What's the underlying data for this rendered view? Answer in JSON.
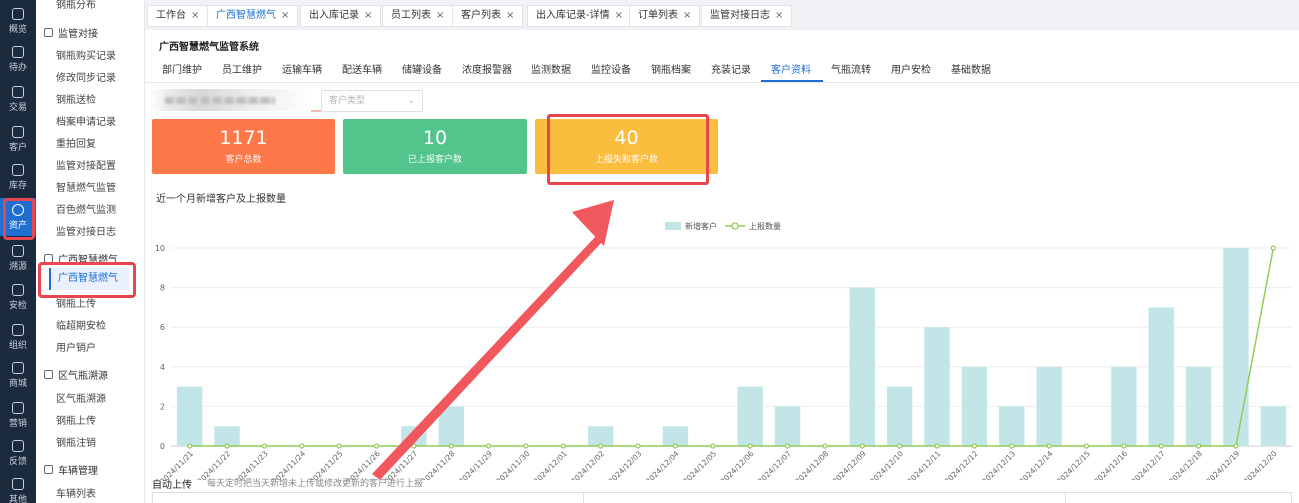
{
  "rail": {
    "items": [
      {
        "label": "概览",
        "icon": "overview-icon"
      },
      {
        "label": "待办",
        "icon": "todo-icon"
      },
      {
        "label": "交易",
        "icon": "transaction-icon"
      },
      {
        "label": "客户",
        "icon": "customer-icon"
      },
      {
        "label": "库存",
        "icon": "inventory-icon"
      },
      {
        "label": "资产",
        "icon": "asset-icon"
      },
      {
        "label": "溯源",
        "icon": "trace-icon"
      },
      {
        "label": "安检",
        "icon": "inspection-icon"
      },
      {
        "label": "组织",
        "icon": "org-icon"
      },
      {
        "label": "商城",
        "icon": "mall-icon"
      },
      {
        "label": "营销",
        "icon": "marketing-icon"
      },
      {
        "label": "反馈",
        "icon": "feedback-icon"
      },
      {
        "label": "其他",
        "icon": "other-icon"
      }
    ]
  },
  "nav": {
    "top_item": "钢瓶分布",
    "group_supervision": "监管对接",
    "supervision_items": [
      "钢瓶购买记录",
      "修改同步记录",
      "钢瓶送检",
      "档案申请记录",
      "重拍回复",
      "监管对接配置",
      "智慧燃气监管",
      "百色燃气监测",
      "监管对接日志"
    ],
    "group_guangxi": "广西智慧燃气",
    "guangxi_items": [
      "广西智慧燃气",
      "钢瓶上传",
      "临超期安检",
      "用户销户"
    ],
    "group_district": "区气瓶溯源",
    "district_items": [
      "区气瓶溯源",
      "钢瓶上传",
      "钢瓶注销"
    ],
    "group_vehicle": "车辆管理",
    "vehicle_items": [
      "车辆列表"
    ]
  },
  "tabs": [
    {
      "label": "工作台"
    },
    {
      "label": "广西智慧燃气"
    },
    {
      "label": "出入库记录"
    },
    {
      "label": "员工列表"
    },
    {
      "label": "客户列表"
    },
    {
      "label": "出入库记录-详情"
    },
    {
      "label": "订单列表"
    },
    {
      "label": "监管对接日志"
    }
  ],
  "close_glyph": "×",
  "main": {
    "system_title": "广西智慧燃气监管系统",
    "subtabs": [
      "部门维护",
      "员工维护",
      "运输车辆",
      "配送车辆",
      "储罐设备",
      "浓度报警器",
      "监测数据",
      "监控设备",
      "钢瓶档案",
      "充装记录",
      "客户资料",
      "气瓶流转",
      "用户安检",
      "基础数据"
    ],
    "active_subtab": "客户资料",
    "customer_type_placeholder": "客户类型",
    "cards": {
      "total": {
        "value": "1171",
        "label": "客户总数",
        "color": "#ff7849"
      },
      "reported": {
        "value": "10",
        "label": "已上报客户数",
        "color": "#53c48c"
      },
      "failed": {
        "value": "40",
        "label": "上报失败客户数",
        "color": "#fbbd3e"
      }
    },
    "auto_upload_label": "自动上传",
    "auto_upload_desc": "每天定时把当天新增未上传或修改更新的客户进行上报"
  },
  "chart_data": {
    "type": "bar",
    "title": "近一个月新增客户及上报数量",
    "categories": [
      "2024/11/21",
      "2024/11/22",
      "2024/11/23",
      "2024/11/24",
      "2024/11/25",
      "2024/11/26",
      "2024/11/27",
      "2024/11/28",
      "2024/11/29",
      "2024/11/30",
      "2024/12/01",
      "2024/12/02",
      "2024/12/03",
      "2024/12/04",
      "2024/12/05",
      "2024/12/06",
      "2024/12/07",
      "2024/12/08",
      "2024/12/09",
      "2024/12/10",
      "2024/12/11",
      "2024/12/12",
      "2024/12/13",
      "2024/12/14",
      "2024/12/15",
      "2024/12/16",
      "2024/12/17",
      "2024/12/18",
      "2024/12/19",
      "2024/12/20"
    ],
    "series": [
      {
        "name": "新增客户",
        "kind": "bar",
        "color": "#c2e6e8",
        "values": [
          3,
          1,
          0,
          0,
          0,
          0,
          1,
          2,
          0,
          0,
          0,
          1,
          0,
          1,
          0,
          3,
          2,
          0,
          8,
          3,
          6,
          4,
          2,
          4,
          0,
          4,
          7,
          4,
          10,
          2
        ]
      },
      {
        "name": "上报数量",
        "kind": "line",
        "color": "#91cc5a",
        "values": [
          0,
          0,
          0,
          0,
          0,
          0,
          0,
          0,
          0,
          0,
          0,
          0,
          0,
          0,
          0,
          0,
          0,
          0,
          0,
          0,
          0,
          0,
          0,
          0,
          0,
          0,
          0,
          0,
          0,
          10
        ]
      }
    ],
    "ylim": [
      0,
      10
    ],
    "yticks": [
      0,
      2,
      4,
      6,
      8,
      10
    ],
    "legend": "top-center",
    "grid": true
  }
}
